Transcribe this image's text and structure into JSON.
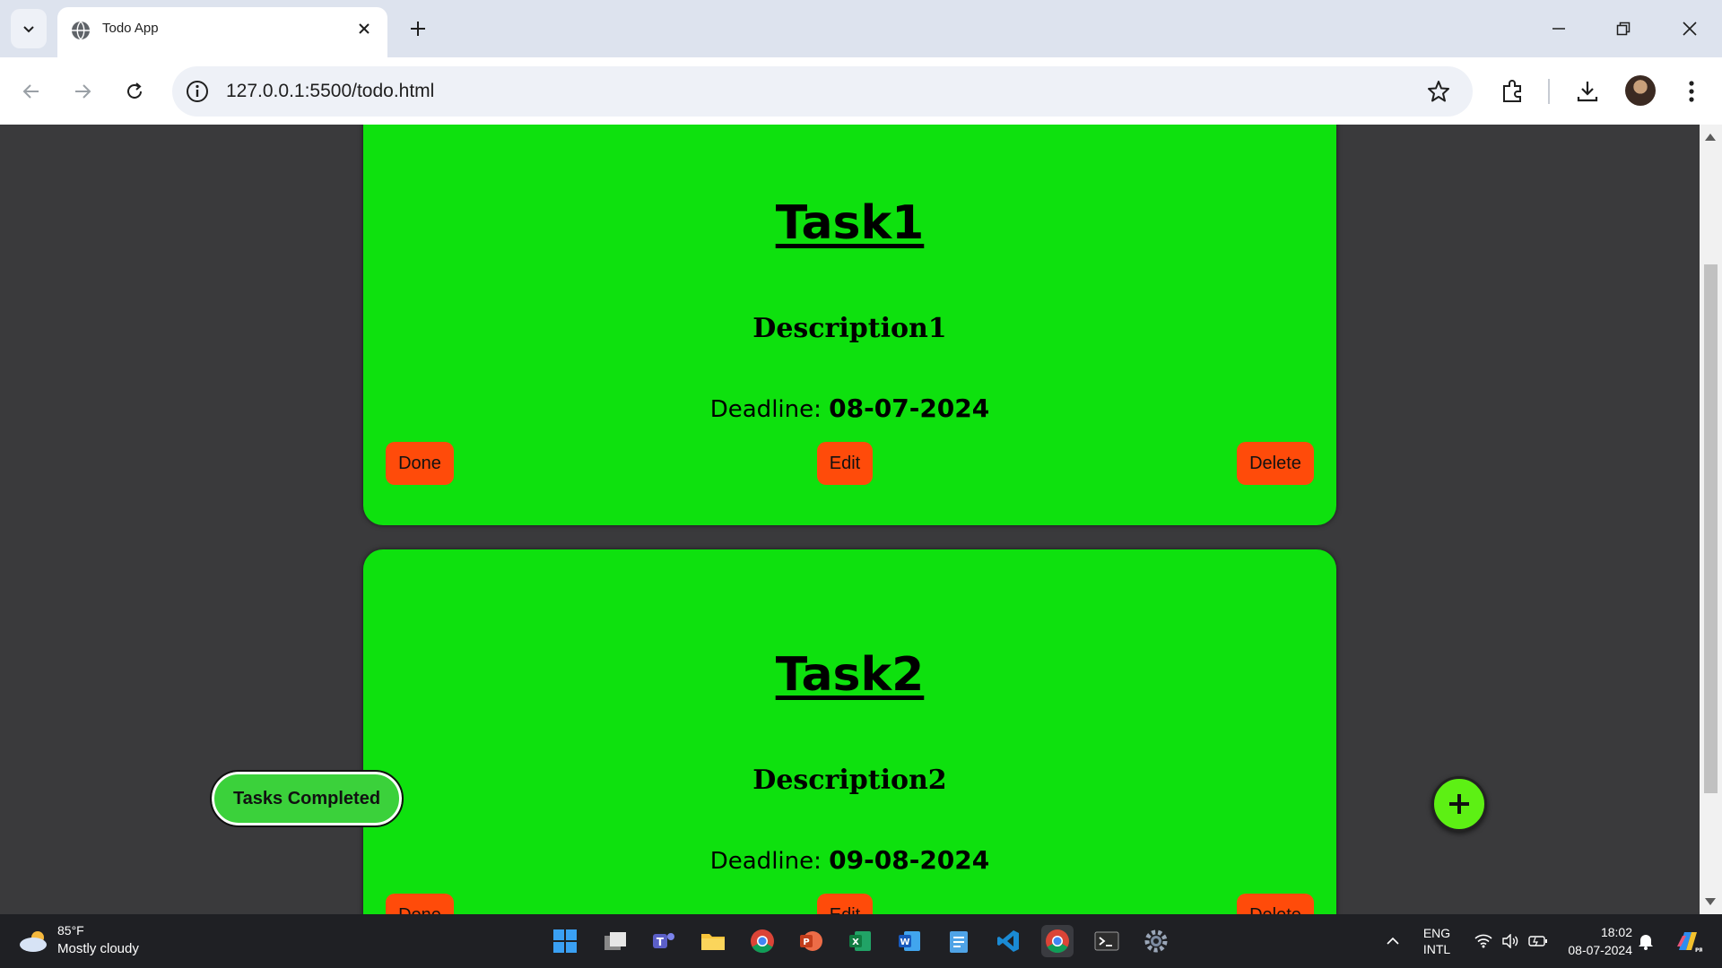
{
  "browser": {
    "tab_title": "Todo App",
    "url": "127.0.0.1:5500/todo.html"
  },
  "tasks": [
    {
      "title": "Task1",
      "description": "Description1",
      "deadline_label": "Deadline:",
      "deadline": "08-07-2024",
      "done_label": "Done",
      "edit_label": "Edit",
      "delete_label": "Delete"
    },
    {
      "title": "Task2",
      "description": "Description2",
      "deadline_label": "Deadline:",
      "deadline": "09-08-2024",
      "done_label": "Done",
      "edit_label": "Edit",
      "delete_label": "Delete"
    }
  ],
  "page": {
    "completed_button": "Tasks Completed",
    "add_button_icon": "plus-icon"
  },
  "taskbar": {
    "weather_temp": "85°F",
    "weather_condition": "Mostly cloudy",
    "language_line1": "ENG",
    "language_line2": "INTL",
    "time": "18:02",
    "date": "08-07-2024"
  },
  "colors": {
    "card_bg": "#0ee10e",
    "button_bg": "#ff4b0a",
    "page_bg": "#3a3a3c",
    "fab_bg": "#5df014",
    "completed_bg": "#3bd13b"
  }
}
